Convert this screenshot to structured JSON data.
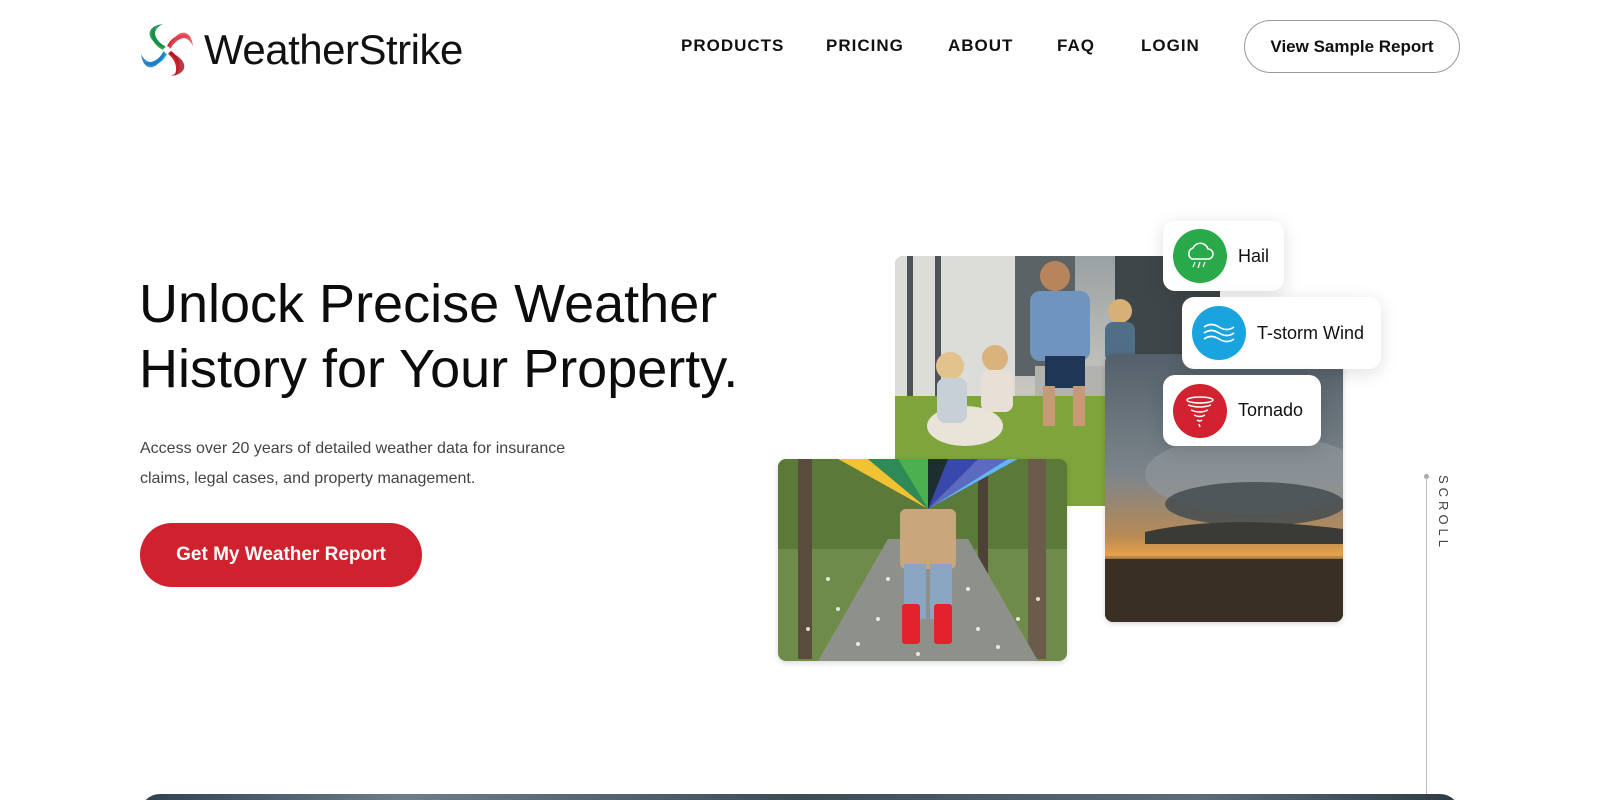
{
  "brand": {
    "name": "WeatherStrike"
  },
  "nav": {
    "items": [
      "PRODUCTS",
      "PRICING",
      "ABOUT",
      "FAQ",
      "LOGIN"
    ]
  },
  "header": {
    "sample_button": "View Sample Report"
  },
  "hero": {
    "headline_line1": "Unlock Precise Weather",
    "headline_line2": "History for Your Property.",
    "subtext": "Access over 20 years of detailed weather data for insurance claims, legal cases, and property management.",
    "cta": "Get My Weather Report"
  },
  "chips": {
    "hail": {
      "label": "Hail",
      "color": "#2aa94b",
      "icon": "hail-cloud-icon"
    },
    "wind": {
      "label": "T-storm Wind",
      "color": "#19a4e0",
      "icon": "wind-icon"
    },
    "tornado": {
      "label": "Tornado",
      "color": "#d3222f",
      "icon": "tornado-icon"
    }
  },
  "scroll": {
    "label": "SCROLL"
  },
  "colors": {
    "accent": "#d0212f",
    "text": "#111111"
  }
}
